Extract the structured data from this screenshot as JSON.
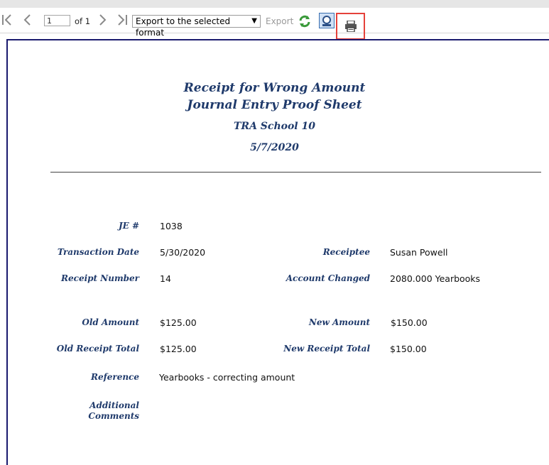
{
  "toolbar": {
    "first_page": "first-page-icon",
    "prev_page": "previous-page-icon",
    "page_value": "1",
    "of_pages": "of 1",
    "next_page": "next-page-icon",
    "last_page": "last-page-icon",
    "export_format": "Export to the selected format",
    "export_label": "Export",
    "refresh": "refresh-icon",
    "zoom": "zoom-icon",
    "print": "print-icon"
  },
  "report": {
    "title_line1": "Receipt for Wrong Amount",
    "title_line2": "Journal Entry Proof Sheet",
    "school": "TRA School 10",
    "date": "5/7/2020",
    "fields": {
      "je_label": "JE #",
      "je_value": "1038",
      "trans_date_label": "Transaction Date",
      "trans_date_value": "5/30/2020",
      "receiptee_label": "Receiptee",
      "receiptee_value": "Susan Powell",
      "receipt_number_label": "Receipt Number",
      "receipt_number_value": "14",
      "account_changed_label": "Account Changed",
      "account_changed_value": "2080.000 Yearbooks",
      "old_amount_label": "Old Amount",
      "old_amount_value": "$125.00",
      "new_amount_label": "New Amount",
      "new_amount_value": "$150.00",
      "old_receipt_total_label": "Old Receipt Total",
      "old_receipt_total_value": "$125.00",
      "new_receipt_total_label": "New Receipt Total",
      "new_receipt_total_value": "$150.00",
      "reference_label": "Reference",
      "reference_value": "Yearbooks - correcting amount",
      "comments_label_line1": "Additional",
      "comments_label_line2": "Comments"
    }
  },
  "colors": {
    "accent_title": "#1f3a6b",
    "highlight_box": "#e5413a",
    "report_border": "#1a1a6e"
  }
}
